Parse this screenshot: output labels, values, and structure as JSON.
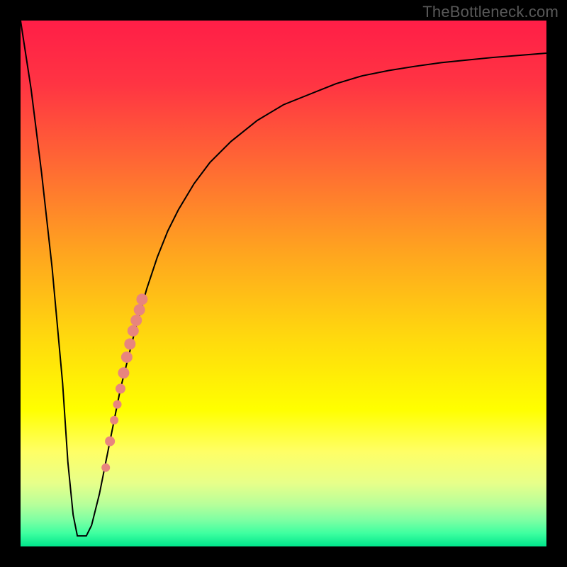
{
  "watermark": {
    "text": "TheBottleneck.com"
  },
  "chart_data": {
    "type": "line",
    "title": "",
    "xlabel": "",
    "ylabel": "",
    "xlim": [
      0,
      100
    ],
    "ylim": [
      0,
      100
    ],
    "grid": false,
    "background_gradient": {
      "stops": [
        {
          "offset": 0.0,
          "color": "#ff1e47"
        },
        {
          "offset": 0.12,
          "color": "#ff3443"
        },
        {
          "offset": 0.28,
          "color": "#ff6b33"
        },
        {
          "offset": 0.44,
          "color": "#ffa41f"
        },
        {
          "offset": 0.6,
          "color": "#ffd80e"
        },
        {
          "offset": 0.74,
          "color": "#ffff00"
        },
        {
          "offset": 0.82,
          "color": "#ffff66"
        },
        {
          "offset": 0.88,
          "color": "#e7ff8a"
        },
        {
          "offset": 0.92,
          "color": "#b7ff9a"
        },
        {
          "offset": 0.95,
          "color": "#7dffa3"
        },
        {
          "offset": 0.975,
          "color": "#3effa0"
        },
        {
          "offset": 1.0,
          "color": "#00e68b"
        }
      ]
    },
    "series": [
      {
        "name": "bottleneck-curve",
        "color": "#000000",
        "stroke_width": 2,
        "x": [
          0,
          2,
          4,
          6,
          8,
          9,
          10,
          10.8,
          11.5,
          12.5,
          13.5,
          15,
          16,
          17,
          18,
          19,
          20,
          22,
          24,
          26,
          28,
          30,
          33,
          36,
          40,
          45,
          50,
          55,
          60,
          65,
          70,
          75,
          80,
          85,
          90,
          95,
          100
        ],
        "y": [
          100,
          87,
          71,
          53,
          31,
          16,
          6,
          2,
          2,
          2,
          4,
          10,
          15,
          20,
          25,
          30,
          34,
          42,
          49,
          55,
          60,
          64,
          69,
          73,
          77,
          81,
          84,
          86,
          88,
          89.5,
          90.5,
          91.3,
          92,
          92.5,
          93,
          93.4,
          93.8
        ]
      }
    ],
    "scatter": {
      "name": "highlighted-points",
      "color": "#e8857e",
      "points": [
        {
          "x": 16.2,
          "y": 15,
          "r": 6
        },
        {
          "x": 17.0,
          "y": 20,
          "r": 7
        },
        {
          "x": 17.8,
          "y": 24,
          "r": 6
        },
        {
          "x": 18.4,
          "y": 27,
          "r": 6
        },
        {
          "x": 19.0,
          "y": 30,
          "r": 7
        },
        {
          "x": 19.6,
          "y": 33,
          "r": 8
        },
        {
          "x": 20.2,
          "y": 36,
          "r": 8
        },
        {
          "x": 20.8,
          "y": 38.5,
          "r": 8
        },
        {
          "x": 21.4,
          "y": 41,
          "r": 8
        },
        {
          "x": 22.0,
          "y": 43,
          "r": 8
        },
        {
          "x": 22.6,
          "y": 45,
          "r": 8
        },
        {
          "x": 23.1,
          "y": 47,
          "r": 8
        }
      ]
    }
  }
}
